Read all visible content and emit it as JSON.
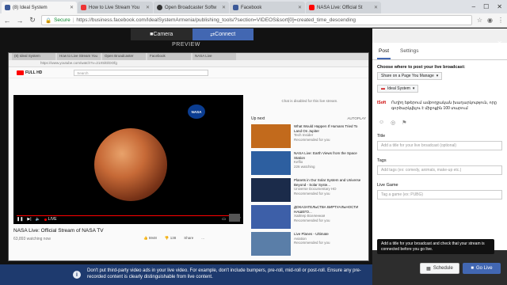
{
  "browser": {
    "tabs": [
      {
        "label": "(8) Ideal System",
        "fav": "#3b5998",
        "active": true
      },
      {
        "label": "How to Live Stream You",
        "fav": "#e33",
        "active": false
      },
      {
        "label": "Open Broadcaster Softw",
        "fav": "#333",
        "active": false
      },
      {
        "label": "Facebook",
        "fav": "#3b5998",
        "active": false
      },
      {
        "label": "NASA Live: Official St",
        "fav": "#f00",
        "active": false
      }
    ],
    "secure_label": "Secure",
    "url": "https://business.facebook.com/IdealSystemArmenia/publishing_tools/?section=VIDEOS&sort[0]=created_time_descending"
  },
  "stage": {
    "camera_tab": "Camera",
    "connect_tab": "Connect",
    "preview_label": "PREVIEW"
  },
  "youtube": {
    "logo_text": "FULL HD",
    "search_placeholder": "Search",
    "url_text": "https://www.youtube.com/watch?v=21X5lGlDOfg",
    "browser_tabs": [
      "(8) Ideal System",
      "How to Live Stream You",
      "Open Broadcaster",
      "Facebook",
      "NASA Live"
    ],
    "chat_disabled": "Chat is disabled for this live stream.",
    "live_label": "LIVE",
    "video_title": "NASA Live: Official Stream of NASA TV",
    "views": "63,893 watching now",
    "actions": [
      "5948",
      "138",
      "Share",
      "..."
    ],
    "up_next": "Up next",
    "autoplay": "AUTOPLAY",
    "recommendations": [
      {
        "title": "What Would Happen If Humans Tried To Land On Jupiter",
        "channel": "Tech Insider",
        "meta": "Recommended for you",
        "color": "#c26a1c"
      },
      {
        "title": "NASA Live: Earth Views from the Space Station",
        "channel": "Keflio",
        "meta": "226 watching",
        "color": "#2d5fa0"
      },
      {
        "title": "Planets in Our Solar System and Universe Beyond - Solar Syste...",
        "channel": "Universe Documentary HD",
        "meta": "Recommended for you",
        "color": "#1b2b4a"
      },
      {
        "title": "ДОКАЗАТЕЛЬСТВА ВИРТУАЛЬНОСТИ НАШЕГО...",
        "channel": "Хайпер Вселенная",
        "meta": "Recommended for you",
        "color": "#3d5fa8"
      },
      {
        "title": "Live Planes - Ultimate",
        "channel": "Aviation",
        "meta": "Recommended for you",
        "color": "#5a7ea8"
      }
    ]
  },
  "banner": {
    "text": "Don't put third-party video ads in your live video. For example, don't include bumpers, pre-roll, mid-roll or post-roll. Ensure any pre-recorded content is clearly distinguishable from live content."
  },
  "panel": {
    "tab_post": "Post",
    "tab_settings": "Settings",
    "where_label": "Choose where to post your live broadcast:",
    "where_value": "Share on a Page You Manage",
    "page_value": "Ideal System",
    "post_tag": "ISoft",
    "post_text": "Ուղիղ եթերում ամբողջական խաղարկություն, որը գործարկվելու է միջոցին 100 տարում",
    "title_label": "Title",
    "title_placeholder": "Add a title for your live broadcast (optional)",
    "tags_label": "Tags",
    "tags_placeholder": "Add tags (ex: comedy, animals, make-up etc.)",
    "game_label": "Live Game",
    "game_placeholder": "Tag a game (ex: PUBG)",
    "tooltip": "Add a title for your broadcast and check that your stream is connected before you go live.",
    "schedule_label": "Schedule",
    "golive_label": "Go Live"
  }
}
